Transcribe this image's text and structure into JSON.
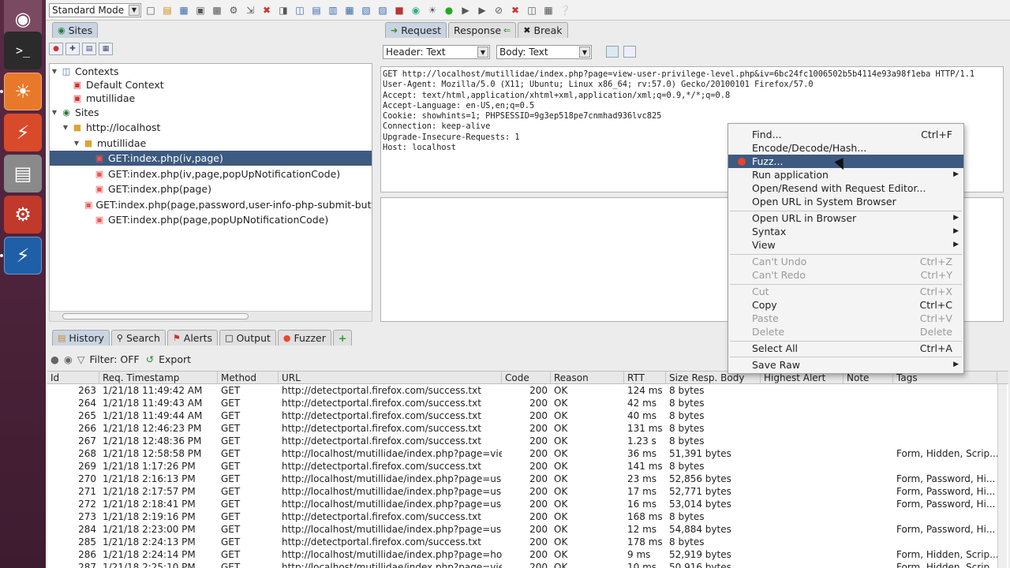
{
  "toolbar": {
    "mode": "Standard Mode"
  },
  "tabs_top": {
    "sites": "Sites",
    "request": "Request",
    "response": "Response",
    "break": "Break"
  },
  "tree": {
    "contexts": "Contexts",
    "default_context": "Default Context",
    "mutillidae_ctx": "mutillidae",
    "sites": "Sites",
    "host": "http://localhost",
    "folder": "mutillidae",
    "items": [
      "GET:index.php(iv,page)",
      "GET:index.php(iv,page,popUpNotificationCode)",
      "GET:index.php(page)",
      "GET:index.php(page,password,user-info-php-submit-button,",
      "GET:index.php(page,popUpNotificationCode)"
    ]
  },
  "view": {
    "header": "Header: Text",
    "body": "Body: Text"
  },
  "request_text": "GET http://localhost/mutillidae/index.php?page=view-user-privilege-level.php&iv=6bc24fc1006502b5b4114e93a98f1eba HTTP/1.1\nUser-Agent: Mozilla/5.0 (X11; Ubuntu; Linux x86_64; rv:57.0) Gecko/20100101 Firefox/57.0\nAccept: text/html,application/xhtml+xml,application/xml;q=0.9,*/*;q=0.8\nAccept-Language: en-US,en;q=0.5\nCookie: showhints=1; PHPSESSID=9g3ep518pe7cnmhad936lvc825\nConnection: keep-alive\nUpgrade-Insecure-Requests: 1\nHost: localhost",
  "bottom_tabs": {
    "history": "History",
    "search": "Search",
    "alerts": "Alerts",
    "output": "Output",
    "fuzzer": "Fuzzer",
    "add": "+"
  },
  "filter": {
    "label": "Filter: OFF",
    "export": "Export"
  },
  "columns": [
    "Id",
    "Req. Timestamp",
    "Method",
    "URL",
    "Code",
    "Reason",
    "RTT",
    "Size Resp. Body",
    "Highest Alert",
    "Note",
    "Tags"
  ],
  "rows": [
    [
      "263",
      "1/21/18 11:49:42 AM",
      "GET",
      "http://detectportal.firefox.com/success.txt",
      "200",
      "OK",
      "124 ms",
      "8 bytes",
      ""
    ],
    [
      "264",
      "1/21/18 11:49:43 AM",
      "GET",
      "http://detectportal.firefox.com/success.txt",
      "200",
      "OK",
      "42 ms",
      "8 bytes",
      ""
    ],
    [
      "265",
      "1/21/18 11:49:44 AM",
      "GET",
      "http://detectportal.firefox.com/success.txt",
      "200",
      "OK",
      "40 ms",
      "8 bytes",
      ""
    ],
    [
      "266",
      "1/21/18 12:46:23 PM",
      "GET",
      "http://detectportal.firefox.com/success.txt",
      "200",
      "OK",
      "131 ms",
      "8 bytes",
      ""
    ],
    [
      "267",
      "1/21/18 12:48:36 PM",
      "GET",
      "http://detectportal.firefox.com/success.txt",
      "200",
      "OK",
      "1.23 s",
      "8 bytes",
      ""
    ],
    [
      "268",
      "1/21/18 12:58:58 PM",
      "GET",
      "http://localhost/mutillidae/index.php?page=vie...",
      "200",
      "OK",
      "36 ms",
      "51,391 bytes",
      "Form, Hidden, Scrip..."
    ],
    [
      "269",
      "1/21/18 1:17:26 PM",
      "GET",
      "http://detectportal.firefox.com/success.txt",
      "200",
      "OK",
      "141 ms",
      "8 bytes",
      ""
    ],
    [
      "270",
      "1/21/18 2:16:13 PM",
      "GET",
      "http://localhost/mutillidae/index.php?page=use...",
      "200",
      "OK",
      "23 ms",
      "52,856 bytes",
      "Form, Password, Hi..."
    ],
    [
      "271",
      "1/21/18 2:17:57 PM",
      "GET",
      "http://localhost/mutillidae/index.php?page=use...",
      "200",
      "OK",
      "17 ms",
      "52,771 bytes",
      "Form, Password, Hi..."
    ],
    [
      "272",
      "1/21/18 2:18:41 PM",
      "GET",
      "http://localhost/mutillidae/index.php?page=use...",
      "200",
      "OK",
      "16 ms",
      "53,014 bytes",
      "Form, Password, Hi..."
    ],
    [
      "273",
      "1/21/18 2:19:16 PM",
      "GET",
      "http://detectportal.firefox.com/success.txt",
      "200",
      "OK",
      "168 ms",
      "8 bytes",
      ""
    ],
    [
      "284",
      "1/21/18 2:23:00 PM",
      "GET",
      "http://localhost/mutillidae/index.php?page=use...",
      "200",
      "OK",
      "12 ms",
      "54,884 bytes",
      "Form, Password, Hi..."
    ],
    [
      "285",
      "1/21/18 2:24:13 PM",
      "GET",
      "http://detectportal.firefox.com/success.txt",
      "200",
      "OK",
      "178 ms",
      "8 bytes",
      ""
    ],
    [
      "286",
      "1/21/18 2:24:14 PM",
      "GET",
      "http://localhost/mutillidae/index.php?page=ho...",
      "200",
      "OK",
      "9 ms",
      "52,919 bytes",
      "Form, Hidden, Scrip..."
    ],
    [
      "287",
      "1/21/18 2:25:10 PM",
      "GET",
      "http://localhost/mutillidae/index.php?page=vie...",
      "200",
      "OK",
      "10 ms",
      "50,916 bytes",
      "Form, Hidden, Scrip..."
    ]
  ],
  "menu": {
    "find": "Find...",
    "find_sc": "Ctrl+F",
    "encode": "Encode/Decode/Hash...",
    "fuzz": "Fuzz...",
    "run": "Run application",
    "resend": "Open/Resend with Request Editor...",
    "open_sys": "Open URL in System Browser",
    "open_browser": "Open URL in Browser",
    "syntax": "Syntax",
    "view": "View",
    "undo": "Can't Undo",
    "undo_sc": "Ctrl+Z",
    "redo": "Can't Redo",
    "redo_sc": "Ctrl+Y",
    "cut": "Cut",
    "cut_sc": "Ctrl+X",
    "copy": "Copy",
    "copy_sc": "Ctrl+C",
    "paste": "Paste",
    "paste_sc": "Ctrl+V",
    "delete": "Delete",
    "delete_sc": "Delete",
    "select_all": "Select All",
    "select_all_sc": "Ctrl+A",
    "save_raw": "Save Raw"
  }
}
